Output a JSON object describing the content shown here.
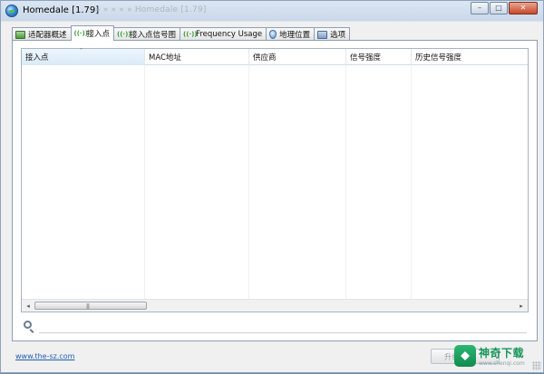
{
  "window": {
    "title": "Homedale [1.79]",
    "ghost_title": "» » » » » Homedale [1.79]",
    "minimize": "–",
    "maximize": "□",
    "close": "✕"
  },
  "tabs": [
    {
      "label": "适配器概述",
      "icon": "adapter-icon"
    },
    {
      "label": "接入点",
      "icon": "wifi-icon",
      "active": true
    },
    {
      "label": "接入点信号图",
      "icon": "wifi-icon"
    },
    {
      "label": "Frequency Usage",
      "icon": "wifi-icon"
    },
    {
      "label": "地理位置",
      "icon": "map-pin-icon"
    },
    {
      "label": "选项",
      "icon": "options-icon"
    }
  ],
  "icon_glyphs": {
    "wifi": "((·))",
    "sort": "˄",
    "scroll_left": "◂",
    "scroll_right": "▸",
    "grip": "|||"
  },
  "list": {
    "columns": [
      "接入点",
      "MAC地址",
      "供应商",
      "信号强度",
      "历史信号强度"
    ],
    "rows": []
  },
  "search": {
    "value": "",
    "placeholder": ""
  },
  "footer": {
    "link": "www.the-sz.com",
    "button_label": "升级"
  },
  "watermark": {
    "name": "神奇下载",
    "url": "www.shenqi.com"
  },
  "colors": {
    "accent": "#3c9a3c",
    "link": "#1d5fb3",
    "watermark": "#16955a"
  }
}
